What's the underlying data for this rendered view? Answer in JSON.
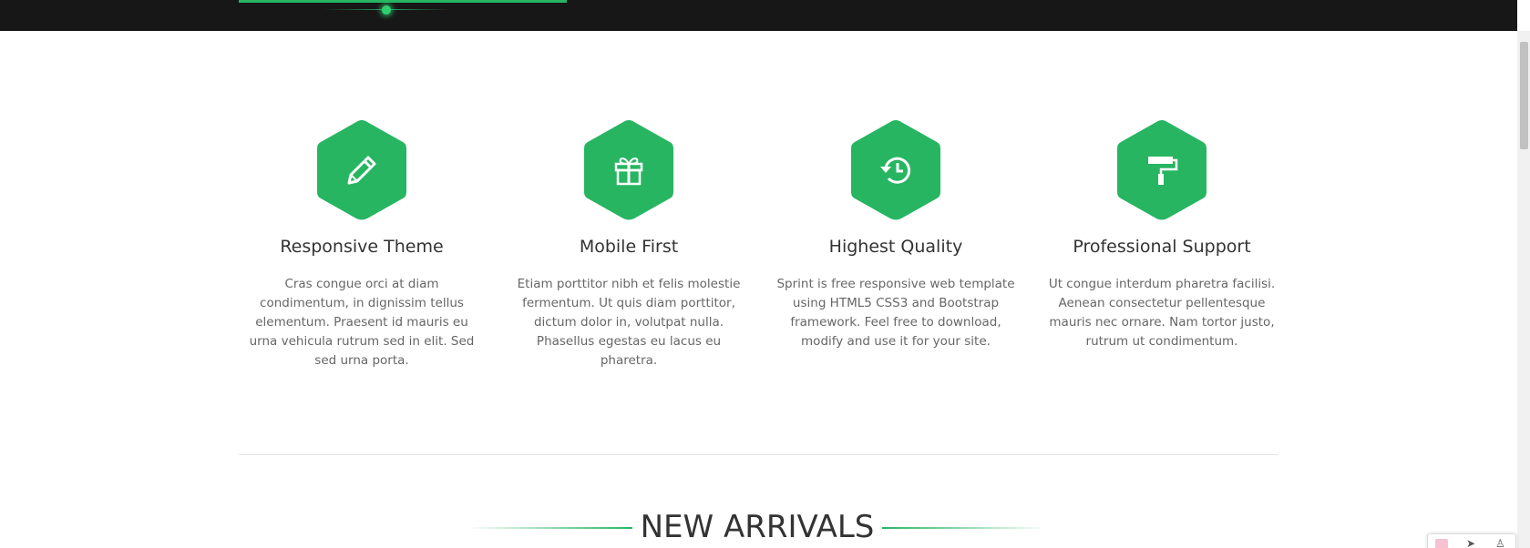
{
  "colors": {
    "accent": "#27b562",
    "topbar_bg": "#171717",
    "title_text": "#333333",
    "body_text": "#666666"
  },
  "features": [
    {
      "icon": "pencil-icon",
      "title": "Responsive Theme",
      "description": "Cras congue orci at diam condimentum, in dignissim tellus elementum. Praesent id mauris eu urna vehicula rutrum sed in elit. Sed sed urna porta."
    },
    {
      "icon": "gift-icon",
      "title": "Mobile First",
      "description": "Etiam porttitor nibh et felis molestie fermentum. Ut quis diam porttitor, dictum dolor in, volutpat nulla. Phasellus egestas eu lacus eu pharetra."
    },
    {
      "icon": "history-icon",
      "title": "Highest Quality",
      "description": "Sprint is free responsive web template using HTML5 CSS3 and Bootstrap framework. Feel free to download, modify and use it for your site."
    },
    {
      "icon": "paint-roller-icon",
      "title": "Professional Support",
      "description": "Ut congue interdum pharetra facilisi. Aenean consectetur pellentesque mauris nec ornare. Nam tortor justo, rutrum ut condimentum."
    }
  ],
  "arrivals": {
    "title": "NEW ARRIVALS"
  }
}
